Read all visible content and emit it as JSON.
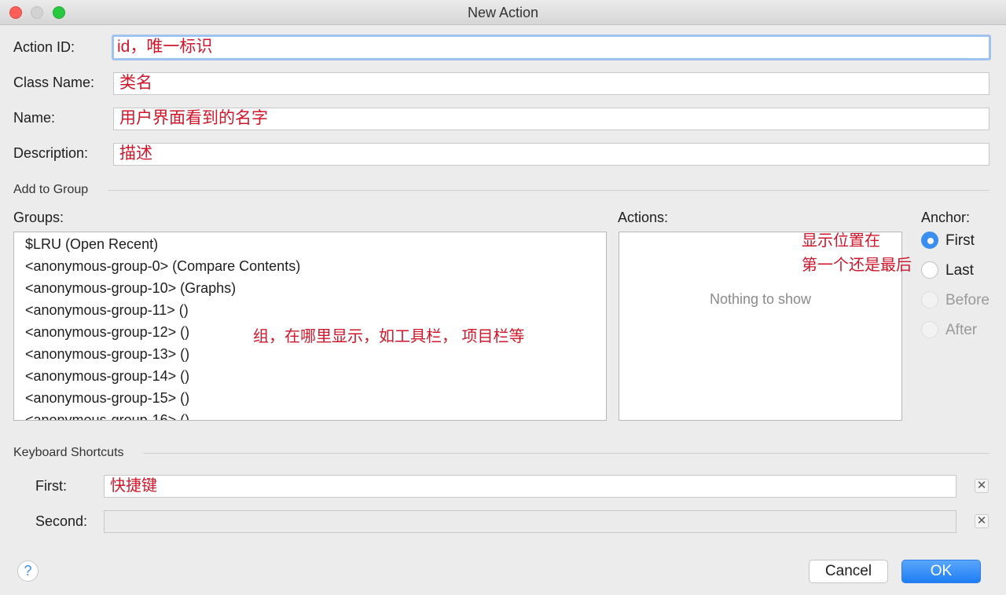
{
  "window": {
    "title": "New Action"
  },
  "fields": {
    "action_id": {
      "label": "Action ID:",
      "value": "id，唯一标识"
    },
    "class_name": {
      "label": "Class Name:",
      "value": "类名"
    },
    "name": {
      "label": "Name:",
      "value": "用户界面看到的名字"
    },
    "description": {
      "label": "Description:",
      "value": "描述"
    }
  },
  "add_to_group": {
    "title": "Add to Group",
    "groups_label": "Groups:",
    "actions_label": "Actions:",
    "anchor_label": "Anchor:",
    "groups": [
      "$LRU (Open Recent)",
      "<anonymous-group-0> (Compare Contents)",
      "<anonymous-group-10> (Graphs)",
      "<anonymous-group-11> ()",
      "<anonymous-group-12> ()",
      "<anonymous-group-13> ()",
      "<anonymous-group-14> ()",
      "<anonymous-group-15> ()",
      "<anonymous-group-16> ()"
    ],
    "actions_empty": "Nothing to show",
    "anchor_options": [
      {
        "label": "First",
        "selected": true,
        "enabled": true
      },
      {
        "label": "Last",
        "selected": false,
        "enabled": true
      },
      {
        "label": "Before",
        "selected": false,
        "enabled": false
      },
      {
        "label": "After",
        "selected": false,
        "enabled": false
      }
    ],
    "groups_note": "组，在哪里显示，如工具栏， 项目栏等",
    "anchor_note_1": "显示位置在",
    "anchor_note_2": "第一个还是最后"
  },
  "shortcuts": {
    "title": "Keyboard Shortcuts",
    "first_label": "First:",
    "first_value": "快捷键",
    "second_label": "Second:",
    "second_value": "",
    "clear": "✕"
  },
  "footer": {
    "help": "?",
    "cancel": "Cancel",
    "ok": "OK"
  }
}
